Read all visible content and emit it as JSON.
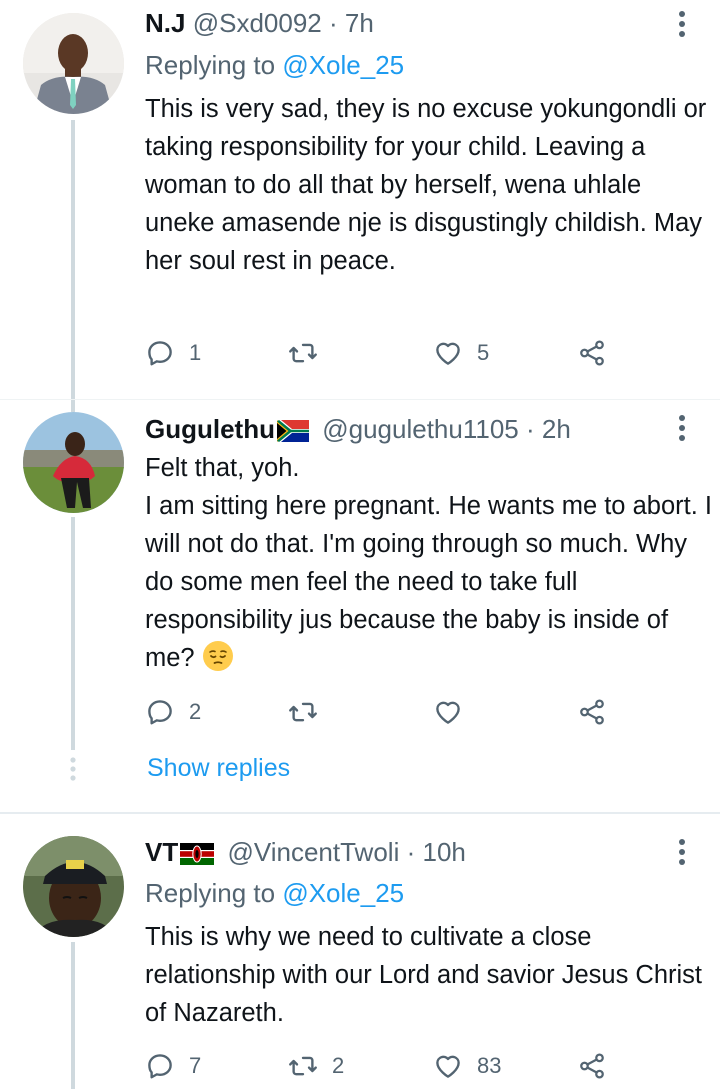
{
  "tweets": [
    {
      "name": "N.J",
      "handle": "@Sxd0092",
      "sep": "·",
      "time": "7h",
      "replying_prefix": "Replying to",
      "replying_to": "@Xole_25",
      "text": "This is very sad, they is no excuse yokungondli or taking responsibility for your child. Leaving a woman to do all that by herself, wena uhlale uneke amasende nje is disgustingly childish. May her soul rest in peace.",
      "replies": "1",
      "retweets": "",
      "likes": "5"
    },
    {
      "name": "Gugulethu",
      "handle": "@gugulethu1105",
      "sep": "·",
      "time": "2h",
      "text_line1": "Felt that, yoh.",
      "text": "I am sitting here pregnant. He wants me to abort. I will not do that. I'm going through so much. Why do some  men feel the need to take full responsibility jus because the baby is inside of me?",
      "replies": "2",
      "retweets": "",
      "likes": ""
    },
    {
      "name": "VT",
      "handle": "@VincentTwoli",
      "sep": "·",
      "time": "10h",
      "replying_prefix": "Replying to",
      "replying_to": "@Xole_25",
      "text": "This is why we need to cultivate a close relationship with our Lord and savior Jesus Christ of Nazareth.",
      "replies": "7",
      "retweets": "2",
      "likes": "83"
    }
  ],
  "show_replies": "Show replies",
  "colors": {
    "link": "#1d9bf0",
    "secondary": "#536471",
    "text": "#0f1419",
    "thread_line": "#cfd9de"
  }
}
